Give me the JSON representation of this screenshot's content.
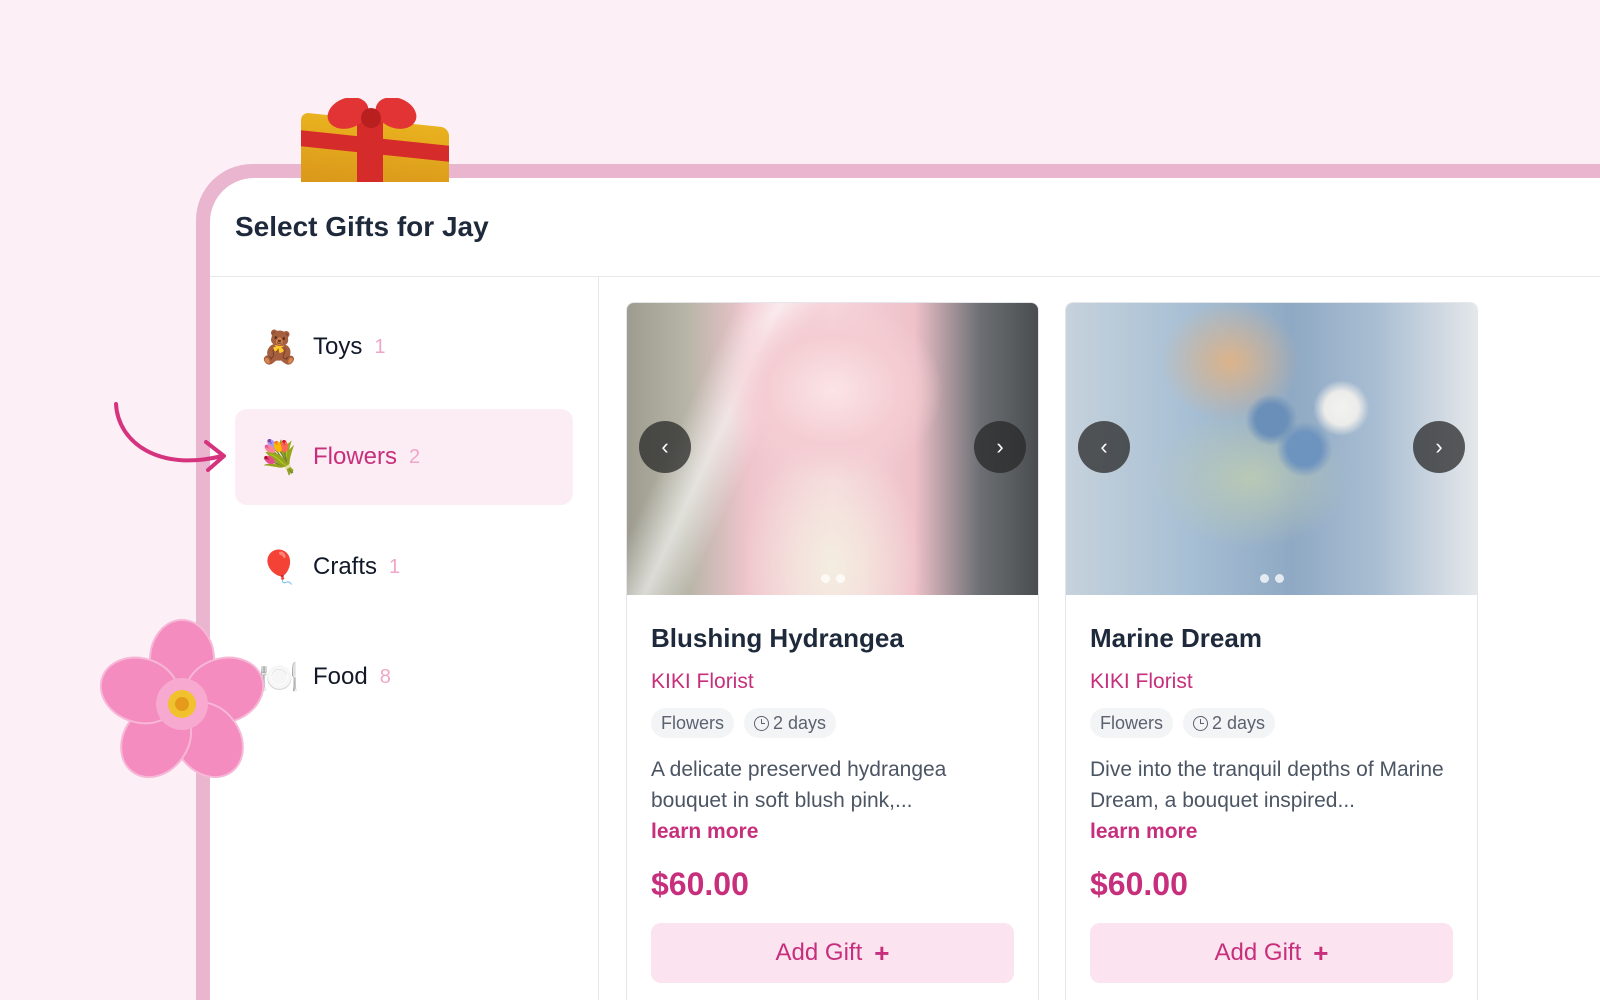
{
  "page": {
    "title": "Select Gifts for Jay"
  },
  "categories": [
    {
      "label": "Toys",
      "count": "1",
      "icon": "teddy-bear-icon",
      "glyph": "🧸",
      "active": false
    },
    {
      "label": "Flowers",
      "count": "2",
      "icon": "bouquet-icon",
      "glyph": "💐",
      "active": true
    },
    {
      "label": "Crafts",
      "count": "1",
      "icon": "balloon-icon",
      "glyph": "🎈",
      "active": false
    },
    {
      "label": "Food",
      "count": "8",
      "icon": "plate-icon",
      "glyph": "🍽️",
      "active": false
    }
  ],
  "products": [
    {
      "name": "Blushing Hydrangea",
      "vendor": "KIKI Florist",
      "category_tag": "Flowers",
      "delivery": "2 days",
      "description": "A delicate preserved hydrangea bouquet in soft blush pink,...",
      "learn_more": "learn more",
      "price": "$60.00",
      "add_label": "Add Gift",
      "image_dots": 2
    },
    {
      "name": "Marine Dream",
      "vendor": "KIKI Florist",
      "category_tag": "Flowers",
      "delivery": "2 days",
      "description": "Dive into the tranquil depths of Marine Dream, a bouquet inspired...",
      "learn_more": "learn more",
      "price": "$60.00",
      "add_label": "Add Gift",
      "image_dots": 2
    }
  ],
  "colors": {
    "accent": "#c72f7c",
    "background": "#fcf0f6",
    "frame": "#eab6cf"
  }
}
